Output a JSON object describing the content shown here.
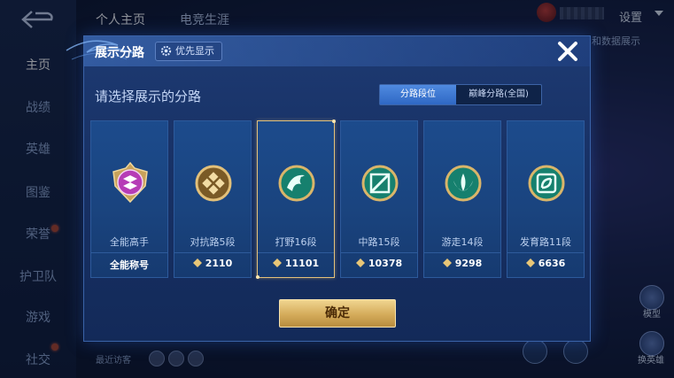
{
  "background": {
    "top_tabs": [
      "个人主页",
      "电竞生涯"
    ],
    "settings_label": "设置",
    "sidebar_items": [
      "主页",
      "战绩",
      "英雄",
      "图鉴",
      "荣誉",
      "护卫队",
      "游戏",
      "社交"
    ],
    "right_tag": "和数据展示",
    "recent_visitors_label": "最近访客",
    "bottom_right": [
      "模型",
      "换英雄"
    ]
  },
  "modal": {
    "title": "展示分路",
    "priority_button": "优先显示",
    "subtitle": "请选择展示的分路",
    "toggle": [
      "分路段位",
      "巅峰分路(全国)"
    ],
    "selected_toggle": "分路段位",
    "confirm_label": "确定",
    "cards": [
      {
        "label": "全能高手",
        "score": "全能称号",
        "badge_color": "#b63cb6",
        "icon": "allround-icon",
        "has_score_icon": false
      },
      {
        "label": "对抗路5段",
        "score": "2110",
        "badge_color": "#b48a3a",
        "icon": "clash-lane-icon",
        "has_score_icon": true
      },
      {
        "label": "打野16段",
        "score": "11101",
        "badge_color": "#1f9c86",
        "icon": "jungle-icon",
        "has_score_icon": true,
        "selected": true
      },
      {
        "label": "中路15段",
        "score": "10378",
        "badge_color": "#1f9c86",
        "icon": "mid-lane-icon",
        "has_score_icon": true
      },
      {
        "label": "游走14段",
        "score": "9298",
        "badge_color": "#1f9c86",
        "icon": "roam-icon",
        "has_score_icon": true
      },
      {
        "label": "发育路11段",
        "score": "6636",
        "badge_color": "#1f9c86",
        "icon": "farm-lane-icon",
        "has_score_icon": true
      }
    ]
  },
  "colors": {
    "accent_gold": "#e4c17a",
    "modal_blue": "#183165",
    "toggle_selected": "#3f7bd6"
  }
}
